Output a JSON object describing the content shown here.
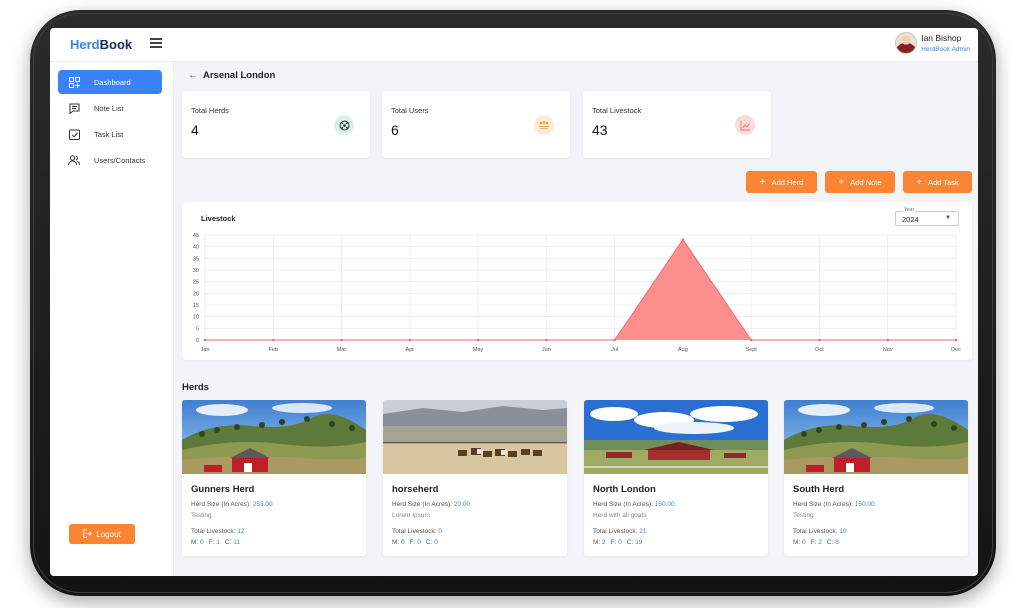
{
  "app": {
    "logo_part1": "Herd",
    "logo_part2": "Book"
  },
  "user": {
    "name": "Ian Bishop",
    "role": "HerdBook Admin"
  },
  "sidebar": {
    "items": [
      {
        "label": "Dashboard",
        "icon": "dashboard-icon",
        "active": true
      },
      {
        "label": "Note List",
        "icon": "note-icon",
        "active": false
      },
      {
        "label": "Task List",
        "icon": "task-icon",
        "active": false
      },
      {
        "label": "Users/Contacts",
        "icon": "users-icon",
        "active": false
      }
    ],
    "logout_label": "Logout"
  },
  "page": {
    "title": "Arsenal London"
  },
  "stats": [
    {
      "label": "Total Herds",
      "value": "4",
      "icon": "herd-icon",
      "color": "#d7f3ea"
    },
    {
      "label": "Total Users",
      "value": "6",
      "icon": "users-icon",
      "color": "#fdecd6"
    },
    {
      "label": "Total Livestock",
      "value": "43",
      "icon": "chart-icon",
      "color": "#fbdcd8"
    }
  ],
  "actions": {
    "add_herd": "Add Herd",
    "add_note": "Add Note",
    "add_task": "Add Task"
  },
  "chart": {
    "year_label": "Year",
    "year_value": "2024"
  },
  "chart_data": {
    "type": "area",
    "title": "Livestock",
    "categories": [
      "Jan",
      "Feb",
      "Mar",
      "Apr",
      "May",
      "Jun",
      "Jul",
      "Aug",
      "Sept",
      "Oct",
      "Nov",
      "Dec"
    ],
    "series": [
      {
        "values": [
          0,
          0,
          0,
          0,
          0,
          0,
          0,
          43,
          0,
          0,
          0,
          0
        ]
      }
    ],
    "ylim": [
      0,
      45
    ],
    "yticks": [
      0,
      5,
      10,
      15,
      20,
      25,
      30,
      35,
      40,
      45
    ],
    "grid": true,
    "color": "#ff8f8f",
    "line_color": "#f26b6b"
  },
  "herds_section": {
    "title": "Herds"
  },
  "labels": {
    "size": "Herd Size (In Acres): ",
    "total": "Total Livestock: ",
    "m": "M: ",
    "f": "F: ",
    "c": "C: "
  },
  "herds": [
    {
      "name": "Gunners Herd",
      "size": "253.00",
      "description": "Testing",
      "total": "12",
      "m": "0",
      "f": "1",
      "c": "11",
      "scene": "hills-barn"
    },
    {
      "name": "horseherd",
      "size": "20.00",
      "description": "Lorem Ipsum",
      "total": "0",
      "m": "0",
      "f": "0",
      "c": "0",
      "scene": "horses"
    },
    {
      "name": "North London",
      "size": "150.00",
      "description": "Herd with all goats",
      "total": "21",
      "m": "2",
      "f": "0",
      "c": "19",
      "scene": "ranch"
    },
    {
      "name": "South Herd",
      "size": "150.00",
      "description": "Testing",
      "total": "10",
      "m": "0",
      "f": "2",
      "c": "8",
      "scene": "hills-barn"
    }
  ]
}
